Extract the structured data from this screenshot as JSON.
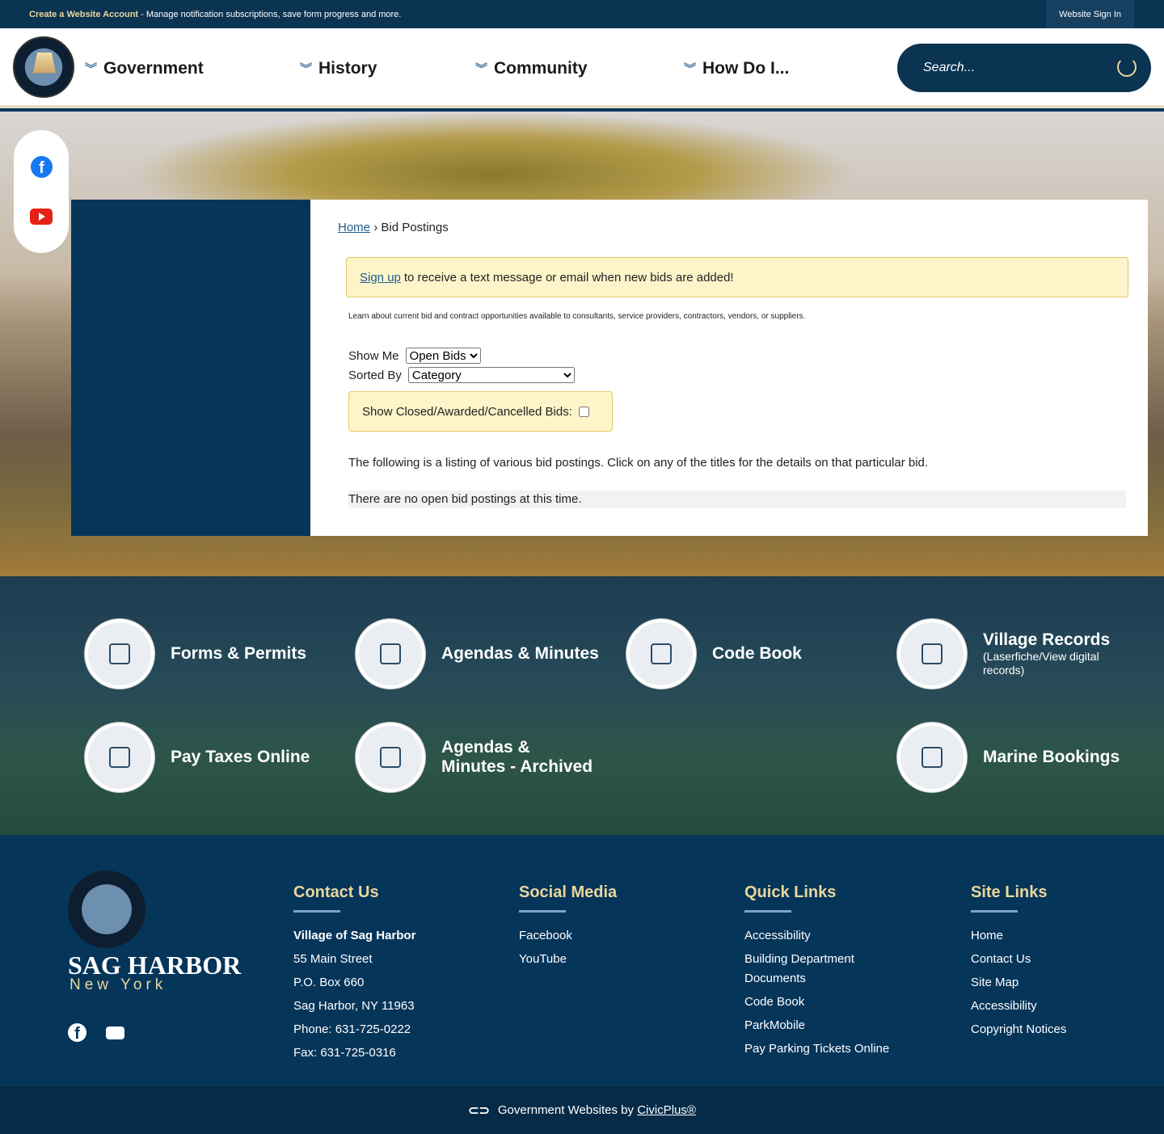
{
  "topbar": {
    "create": "Create a Website Account",
    "desc": " - Manage notification subscriptions, save form progress and more.",
    "signin": "Website Sign In"
  },
  "nav": [
    {
      "label": "Government"
    },
    {
      "label": "History"
    },
    {
      "label": "Community"
    },
    {
      "label": "How Do I..."
    }
  ],
  "search": {
    "placeholder": "Search..."
  },
  "breadcrumb": {
    "home": "Home",
    "sep": "›",
    "current": "Bid Postings"
  },
  "alert": {
    "link": "Sign up",
    "text": "to receive a text message or email when new bids are added!"
  },
  "learn": "Learn about current bid and contract opportunities available to consultants, service providers, contractors, vendors, or suppliers.",
  "filters": {
    "show_label": "Show Me",
    "show_value": "Open Bids",
    "sort_label": "Sorted By",
    "sort_value": "Category",
    "closed_label": "Show Closed/Awarded/Cancelled Bids:"
  },
  "listing": "The following is a listing of various bid postings. Click on any of the titles for the details on that particular bid.",
  "none": "There are no open bid postings at this time.",
  "quicklinks": [
    {
      "title": "Forms & Permits"
    },
    {
      "title": "Agendas & Minutes"
    },
    {
      "title": "Code Book"
    },
    {
      "title": "Village Records",
      "sub": "(Laserfiche/View digital records)"
    },
    {
      "title": "Pay Taxes Online"
    },
    {
      "title": "Agendas & Minutes - Archived"
    },
    {
      "title": "Marine Bookings"
    }
  ],
  "footer": {
    "name": "SAG HARBOR",
    "state": "New York",
    "contact": {
      "heading": "Contact Us",
      "org": "Village of Sag Harbor",
      "lines": [
        "55 Main Street",
        "P.O. Box 660",
        "Sag Harbor, NY 11963",
        "Phone: 631-725-0222",
        "Fax: 631-725-0316"
      ]
    },
    "social": {
      "heading": "Social Media",
      "items": [
        "Facebook",
        "YouTube"
      ]
    },
    "quick": {
      "heading": "Quick Links",
      "items": [
        "Accessibility",
        "Building Department Documents",
        "Code Book",
        "ParkMobile",
        "Pay Parking Tickets Online"
      ]
    },
    "site": {
      "heading": "Site Links",
      "items": [
        "Home",
        "Contact Us",
        "Site Map",
        "Accessibility",
        "Copyright Notices"
      ]
    }
  },
  "bottom": {
    "text": "Government Websites by",
    "link": "CivicPlus®"
  }
}
